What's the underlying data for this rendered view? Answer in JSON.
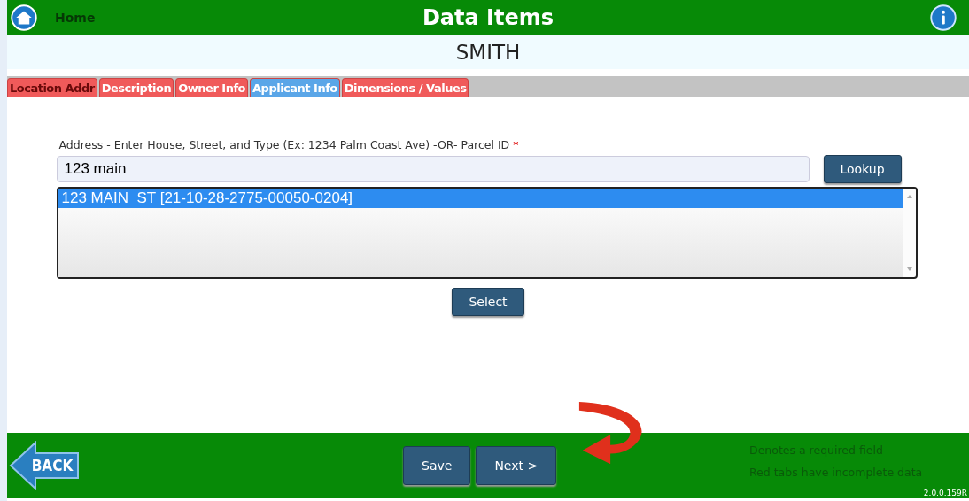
{
  "header": {
    "home": "Home",
    "title": "Data Items"
  },
  "record_name": "SMITH",
  "tabs": [
    {
      "label": "Location Addr",
      "selected": true,
      "color": "#f05a5a"
    },
    {
      "label": "Description",
      "selected": false,
      "color": "#f05a5a"
    },
    {
      "label": "Owner Info",
      "selected": false,
      "color": "#f05a5a"
    },
    {
      "label": "Applicant Info",
      "selected": false,
      "color": "#5aa6e8"
    },
    {
      "label": "Dimensions / Values",
      "selected": false,
      "color": "#f05a5a"
    }
  ],
  "address": {
    "label": "Address - Enter House, Street, and Type (Ex: 1234 Palm Coast Ave) -OR- Parcel ID",
    "required_mark": "*",
    "value": "123 main",
    "lookup": "Lookup"
  },
  "results": [
    {
      "text": "123 MAIN  ST [21-10-28-2775-00050-0204]",
      "selected": true
    }
  ],
  "select_button": "Select",
  "footer": {
    "back": "BACK",
    "save": "Save",
    "next": "Next >",
    "notes": [
      "Denotes a required field",
      "Red tabs have incomplete data"
    ],
    "version": "2.0.0.159R"
  }
}
